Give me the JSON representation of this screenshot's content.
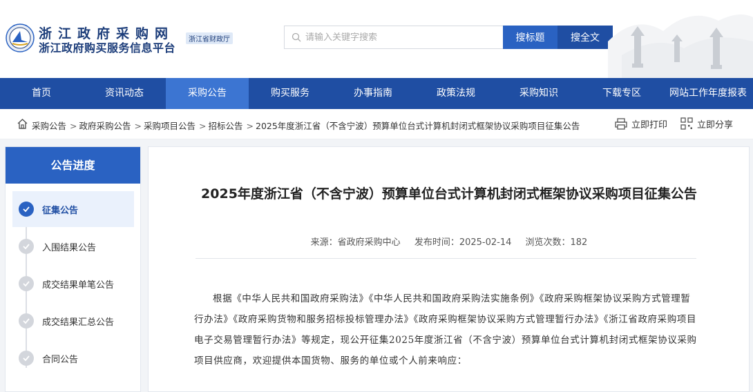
{
  "header": {
    "logo_line1": "浙江政府采购网",
    "logo_line2": "浙江政府购买服务信息平台",
    "logo_badge": "浙江省财政厅",
    "search_placeholder": "请输入关键字搜索",
    "search_title_button": "搜标题",
    "search_full_button": "搜全文"
  },
  "nav": {
    "items": [
      {
        "label": "首页"
      },
      {
        "label": "资讯动态"
      },
      {
        "label": "采购公告",
        "active": true
      },
      {
        "label": "购买服务"
      },
      {
        "label": "办事指南"
      },
      {
        "label": "政策法规"
      },
      {
        "label": "采购知识"
      },
      {
        "label": "下载专区"
      },
      {
        "label": "网站工作年度报表"
      }
    ]
  },
  "breadcrumb": {
    "items": [
      "采购公告",
      "政府采购公告",
      "采购项目公告",
      "招标公告",
      "2025年度浙江省（不含宁波）预算单位台式计算机封闭式框架协议采购项目征集公告"
    ],
    "separator": ">"
  },
  "actions": {
    "print": "立即打印",
    "share": "立即分享"
  },
  "sidebar": {
    "title": "公告进度",
    "steps": [
      {
        "label": "征集公告",
        "active": true
      },
      {
        "label": "入围结果公告"
      },
      {
        "label": "成交结果单笔公告"
      },
      {
        "label": "成交结果汇总公告"
      },
      {
        "label": "合同公告"
      }
    ]
  },
  "article": {
    "title": "2025年度浙江省（不含宁波）预算单位台式计算机封闭式框架协议采购项目征集公告",
    "source": "来源：省政府采购中心",
    "publish_time": "发布时间：2025-02-14",
    "views": "浏览次数：182",
    "paragraph": "根据《中华人民共和国政府采购法》《中华人民共和国政府采购法实施条例》《政府采购框架协议采购方式管理暂行办法》《政府采购货物和服务招标投标管理办法》《政府采购框架协议采购方式管理暂行办法》《浙江省政府采购项目电子交易管理暂行办法》等规定，现公开征集2025年度浙江省（不含宁波）预算单位台式计算机封闭式框架协议采购项目供应商，欢迎提供本国货物、服务的单位或个人前来响应："
  },
  "colors": {
    "nav_bg": "#1f4ea3",
    "nav_active": "#3c75d2",
    "accent": "#2a62c2"
  }
}
